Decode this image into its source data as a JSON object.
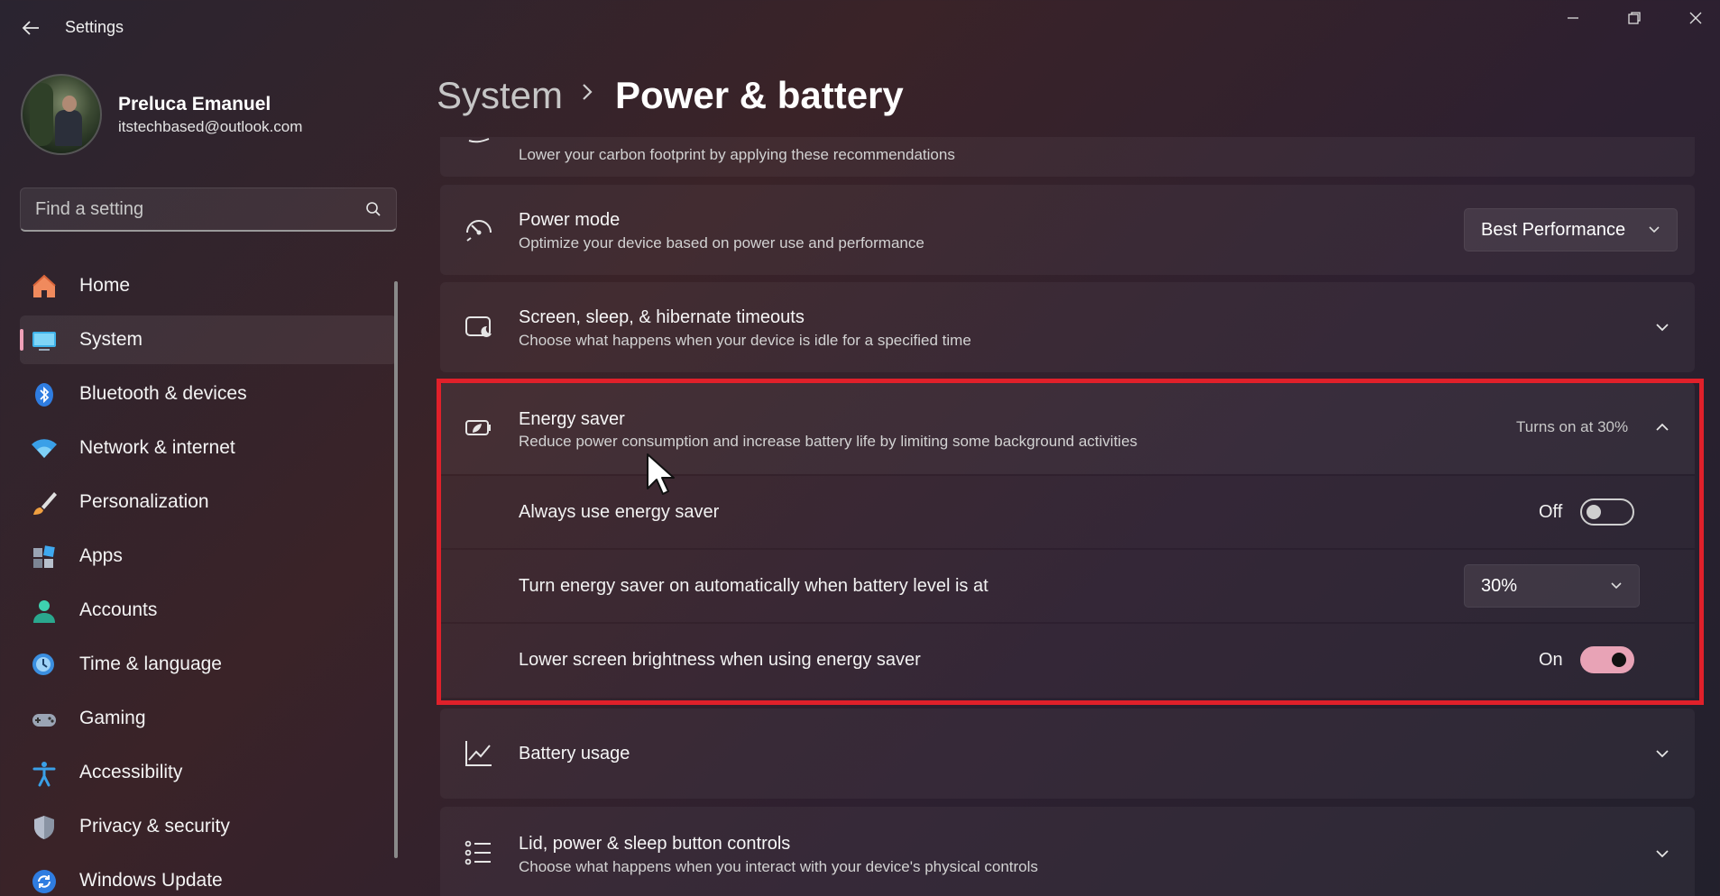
{
  "window": {
    "title": "Settings"
  },
  "profile": {
    "name": "Preluca Emanuel",
    "email": "itstechbased@outlook.com"
  },
  "search": {
    "placeholder": "Find a setting"
  },
  "nav": {
    "items": [
      {
        "label": "Home",
        "icon": "home-icon"
      },
      {
        "label": "System",
        "icon": "system-icon",
        "active": true
      },
      {
        "label": "Bluetooth & devices",
        "icon": "bluetooth-icon"
      },
      {
        "label": "Network & internet",
        "icon": "wifi-icon"
      },
      {
        "label": "Personalization",
        "icon": "brush-icon"
      },
      {
        "label": "Apps",
        "icon": "apps-icon"
      },
      {
        "label": "Accounts",
        "icon": "account-icon"
      },
      {
        "label": "Time & language",
        "icon": "globe-clock-icon"
      },
      {
        "label": "Gaming",
        "icon": "gamepad-icon"
      },
      {
        "label": "Accessibility",
        "icon": "accessibility-icon"
      },
      {
        "label": "Privacy & security",
        "icon": "shield-icon"
      },
      {
        "label": "Windows Update",
        "icon": "update-icon"
      }
    ]
  },
  "breadcrumb": {
    "root": "System",
    "page": "Power & battery"
  },
  "cards": {
    "recommendations": {
      "desc": "Lower your carbon footprint by applying these recommendations"
    },
    "power_mode": {
      "title": "Power mode",
      "desc": "Optimize your device based on power use and performance",
      "value": "Best Performance"
    },
    "timeouts": {
      "title": "Screen, sleep, & hibernate timeouts",
      "desc": "Choose what happens when your device is idle for a specified time"
    },
    "energy_saver": {
      "title": "Energy saver",
      "desc": "Reduce power consumption and increase battery life by limiting some background activities",
      "status": "Turns on at 30%",
      "always_label": "Always use energy saver",
      "always_state": "Off",
      "auto_label": "Turn energy saver on automatically when battery level is at",
      "auto_value": "30%",
      "brightness_label": "Lower screen brightness when using energy saver",
      "brightness_state": "On"
    },
    "battery_usage": {
      "title": "Battery usage"
    },
    "lid_controls": {
      "title": "Lid, power & sleep button controls",
      "desc": "Choose what happens when you interact with your device's physical controls"
    }
  },
  "colors": {
    "accent": "#e8a3b6",
    "highlight": "#e0202a"
  }
}
